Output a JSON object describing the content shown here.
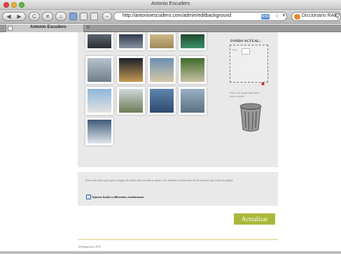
{
  "window": {
    "title": "Antonio Escudero"
  },
  "toolbar": {
    "back_glyph": "◀",
    "forward_glyph": "▶",
    "reload_glyph": "C",
    "stop_glyph": "✕",
    "home_glyph": "⌂",
    "zoom_glyph": "−",
    "url": "http://antonioescudero.com/admin/editbackground",
    "rss_label": "RSS",
    "star_glyph": "☆",
    "chevron_glyph": "▾",
    "search_text": "Diccionario RAE",
    "search_glyph": "Q"
  },
  "tab": {
    "label": "Antonio Escudero",
    "close_glyph": "⊗"
  },
  "gallery": {
    "thumbnails": [
      {
        "name": "thumb-dark-street",
        "colors": [
          "#5d6470",
          "#2b2e33"
        ]
      },
      {
        "name": "thumb-city-night",
        "colors": [
          "#2f3a4d",
          "#8a93a5"
        ]
      },
      {
        "name": "thumb-desert",
        "colors": [
          "#cdb98b",
          "#a18859"
        ]
      },
      {
        "name": "thumb-pool",
        "colors": [
          "#1f4a2f",
          "#3d8f6b"
        ]
      },
      {
        "name": "thumb-beach-waves",
        "colors": [
          "#b7c3cc",
          "#6f7f8a"
        ]
      },
      {
        "name": "thumb-night-palace",
        "colors": [
          "#1c1f2a",
          "#c49a52"
        ]
      },
      {
        "name": "thumb-sea-wave",
        "colors": [
          "#6b8fb3",
          "#d6c7a8"
        ]
      },
      {
        "name": "thumb-deck-chair",
        "colors": [
          "#3e6b2b",
          "#c9c1a5"
        ]
      },
      {
        "name": "thumb-mosque",
        "colors": [
          "#8eb6d9",
          "#e2e2e2"
        ]
      },
      {
        "name": "thumb-taj-mahal",
        "colors": [
          "#d0d6dc",
          "#6f7b55"
        ]
      },
      {
        "name": "thumb-ocean-horizon",
        "colors": [
          "#5e84ad",
          "#2e4a6e"
        ]
      },
      {
        "name": "thumb-tower-bridge",
        "colors": [
          "#9ab0c4",
          "#5a6f80"
        ]
      },
      {
        "name": "thumb-mountain",
        "colors": [
          "#3f5a7a",
          "#dfe5ec"
        ]
      }
    ]
  },
  "current_background": {
    "title": "FONDO ACTUAL:",
    "thumb_label": "cargar",
    "remove_glyph": "✖",
    "hint": "Esto es el fondo que tienes seleccionado"
  },
  "options": {
    "description": "Pulsa más abajo para que la imagen de fondo seleccionada se ajuste a las distintas resoluciones de los usuarios que visiten la página",
    "checkbox_label": "Ajustar fondo a diferentes resoluciones"
  },
  "actions": {
    "update_label": "Actualizar"
  },
  "footer": {
    "text": "MyHgnavmos 2010"
  }
}
